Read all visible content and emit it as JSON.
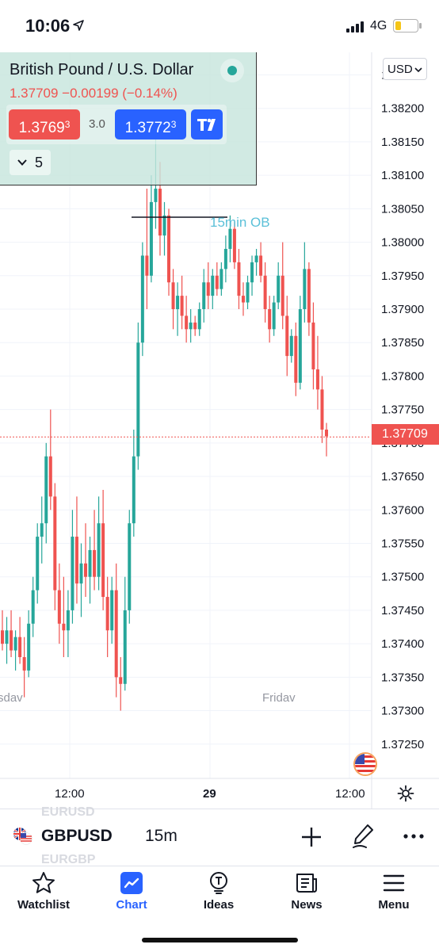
{
  "status_bar": {
    "time": "10:06",
    "network": "4G"
  },
  "instrument": {
    "title": "British Pound / U.S. Dollar",
    "quote": "1.37709  −0.00199 (−0.14%)",
    "sell_price": "1.3769",
    "sell_pipette": "3",
    "spread": "3.0",
    "buy_price": "1.3772",
    "buy_pipette": "3",
    "interval_count": "5"
  },
  "currency": "USD",
  "last_price": "1.37709",
  "annotation": "15min OB",
  "chart": {
    "y_ticks": [
      "1.38250",
      "1.38200",
      "1.38150",
      "1.38100",
      "1.38050",
      "1.38000",
      "1.37950",
      "1.37900",
      "1.37850",
      "1.37800",
      "1.37750",
      "1.37700",
      "1.37650",
      "1.37600",
      "1.37550",
      "1.37500",
      "1.37450",
      "1.37400",
      "1.37350",
      "1.37300",
      "1.37250"
    ],
    "day_labels": [
      "sdav",
      "Fridav"
    ],
    "x_labels": [
      "12:00",
      "29",
      "12:00"
    ],
    "colors": {
      "up": "#26a69a",
      "down": "#ef5350",
      "grid": "#f0f3fa",
      "price_line": "#ef5350"
    }
  },
  "chart_data": {
    "type": "candlestick",
    "symbol": "GBPUSD",
    "interval": "15m",
    "ylim": [
      1.3722,
      1.3827
    ],
    "candles": [
      [
        1.3742,
        1.3745,
        1.3739,
        1.374
      ],
      [
        1.374,
        1.3744,
        1.3737,
        1.3742
      ],
      [
        1.3742,
        1.3745,
        1.3738,
        1.3739
      ],
      [
        1.3739,
        1.3742,
        1.3736,
        1.3741
      ],
      [
        1.3741,
        1.3744,
        1.3737,
        1.3738
      ],
      [
        1.3738,
        1.3741,
        1.3732,
        1.3736
      ],
      [
        1.3736,
        1.3745,
        1.3735,
        1.3743
      ],
      [
        1.3743,
        1.375,
        1.3741,
        1.3748
      ],
      [
        1.3748,
        1.3758,
        1.3746,
        1.3756
      ],
      [
        1.3756,
        1.3762,
        1.3752,
        1.3758
      ],
      [
        1.3758,
        1.377,
        1.3755,
        1.3768
      ],
      [
        1.3768,
        1.3775,
        1.376,
        1.3762
      ],
      [
        1.3762,
        1.3764,
        1.3745,
        1.3748
      ],
      [
        1.3748,
        1.3752,
        1.374,
        1.3743
      ],
      [
        1.3743,
        1.375,
        1.3738,
        1.3742
      ],
      [
        1.3742,
        1.3748,
        1.3738,
        1.3745
      ],
      [
        1.3745,
        1.376,
        1.3743,
        1.3756
      ],
      [
        1.3756,
        1.3762,
        1.3746,
        1.3749
      ],
      [
        1.3749,
        1.3755,
        1.3744,
        1.3752
      ],
      [
        1.3752,
        1.3758,
        1.3747,
        1.375
      ],
      [
        1.375,
        1.3756,
        1.3746,
        1.3754
      ],
      [
        1.3754,
        1.376,
        1.3748,
        1.375
      ],
      [
        1.375,
        1.3762,
        1.3748,
        1.3758
      ],
      [
        1.3758,
        1.3763,
        1.3745,
        1.3747
      ],
      [
        1.3747,
        1.375,
        1.3738,
        1.3742
      ],
      [
        1.3742,
        1.375,
        1.374,
        1.3748
      ],
      [
        1.3748,
        1.3752,
        1.3732,
        1.3735
      ],
      [
        1.3735,
        1.3738,
        1.373,
        1.3734
      ],
      [
        1.3734,
        1.375,
        1.3733,
        1.3745
      ],
      [
        1.3745,
        1.376,
        1.3743,
        1.3758
      ],
      [
        1.3758,
        1.3772,
        1.3756,
        1.3768
      ],
      [
        1.3768,
        1.3788,
        1.3766,
        1.3785
      ],
      [
        1.3785,
        1.38,
        1.3783,
        1.3798
      ],
      [
        1.3798,
        1.3808,
        1.379,
        1.3795
      ],
      [
        1.3795,
        1.381,
        1.3794,
        1.3806
      ],
      [
        1.3806,
        1.3818,
        1.3802,
        1.3808
      ],
      [
        1.3808,
        1.3812,
        1.3798,
        1.3801
      ],
      [
        1.3801,
        1.3806,
        1.3798,
        1.3804
      ],
      [
        1.3804,
        1.3805,
        1.3792,
        1.3794
      ],
      [
        1.3794,
        1.3796,
        1.3787,
        1.379
      ],
      [
        1.379,
        1.3794,
        1.3786,
        1.3792
      ],
      [
        1.3792,
        1.3795,
        1.3787,
        1.3789
      ],
      [
        1.3789,
        1.3792,
        1.3785,
        1.3787
      ],
      [
        1.3787,
        1.379,
        1.3785,
        1.3788
      ],
      [
        1.3788,
        1.3789,
        1.3786,
        1.3787
      ],
      [
        1.3787,
        1.3791,
        1.3786,
        1.379
      ],
      [
        1.379,
        1.3796,
        1.3788,
        1.3794
      ],
      [
        1.3794,
        1.3797,
        1.379,
        1.3792
      ],
      [
        1.3792,
        1.3796,
        1.379,
        1.3795
      ],
      [
        1.3795,
        1.3797,
        1.3792,
        1.3793
      ],
      [
        1.3793,
        1.3797,
        1.3792,
        1.3796
      ],
      [
        1.3796,
        1.3801,
        1.3794,
        1.3799
      ],
      [
        1.3799,
        1.3804,
        1.3797,
        1.3802
      ],
      [
        1.3802,
        1.3803,
        1.3796,
        1.3797
      ],
      [
        1.3797,
        1.3799,
        1.379,
        1.3792
      ],
      [
        1.3792,
        1.3794,
        1.3789,
        1.3791
      ],
      [
        1.3791,
        1.3795,
        1.379,
        1.3794
      ],
      [
        1.3794,
        1.3798,
        1.3792,
        1.3797
      ],
      [
        1.3797,
        1.3799,
        1.3795,
        1.3798
      ],
      [
        1.3798,
        1.38,
        1.3794,
        1.3795
      ],
      [
        1.3795,
        1.3797,
        1.3788,
        1.379
      ],
      [
        1.379,
        1.3792,
        1.3785,
        1.3787
      ],
      [
        1.3787,
        1.3792,
        1.3786,
        1.3791
      ],
      [
        1.3791,
        1.3797,
        1.379,
        1.3795
      ],
      [
        1.3795,
        1.38,
        1.3787,
        1.3789
      ],
      [
        1.3789,
        1.3792,
        1.378,
        1.3783
      ],
      [
        1.3783,
        1.3787,
        1.3782,
        1.3786
      ],
      [
        1.3786,
        1.3788,
        1.3777,
        1.3779
      ],
      [
        1.3779,
        1.3792,
        1.3778,
        1.379
      ],
      [
        1.379,
        1.38,
        1.3788,
        1.3796
      ],
      [
        1.3796,
        1.3797,
        1.3786,
        1.3788
      ],
      [
        1.3788,
        1.3791,
        1.3778,
        1.3781
      ],
      [
        1.3781,
        1.3786,
        1.3775,
        1.3778
      ],
      [
        1.3778,
        1.378,
        1.377,
        1.3772
      ],
      [
        1.3772,
        1.3773,
        1.3768,
        1.3771
      ]
    ]
  },
  "symbol_bar": {
    "symbol": "GBPUSD",
    "timeframe": "15m",
    "prev_symbol": "EURUSD",
    "next_symbol": "EURGBP"
  },
  "tabs": [
    {
      "label": "Watchlist",
      "icon": "star-icon",
      "active": false
    },
    {
      "label": "Chart",
      "icon": "chart-icon",
      "active": true
    },
    {
      "label": "Ideas",
      "icon": "lightbulb-icon",
      "active": false
    },
    {
      "label": "News",
      "icon": "news-icon",
      "active": false
    },
    {
      "label": "Menu",
      "icon": "hamburger-icon",
      "active": false
    }
  ]
}
